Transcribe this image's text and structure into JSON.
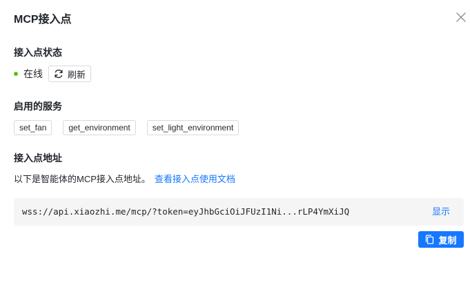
{
  "dialog": {
    "title": "MCP接入点",
    "close_icon": "close-icon"
  },
  "status_section": {
    "label": "接入点状态",
    "status_text": "在线",
    "status_color": "#52c41a",
    "refresh_label": "刷新",
    "refresh_icon": "refresh-icon"
  },
  "services_section": {
    "label": "启用的服务",
    "services": [
      "set_fan",
      "get_environment",
      "set_light_environment"
    ]
  },
  "address_section": {
    "label": "接入点地址",
    "description": "以下是智能体的MCP接入点地址。",
    "docs_link": "查看接入点使用文档",
    "url": "wss://api.xiaozhi.me/mcp/?token=eyJhbGciOiJFUzI1Ni...rLP4YmXiJQ",
    "show_label": "显示",
    "copy_label": "复制",
    "copy_icon": "copy-icon",
    "accent_color": "#1677ff"
  }
}
